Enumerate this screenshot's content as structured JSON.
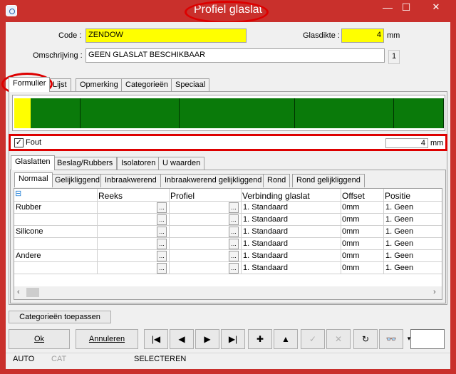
{
  "window": {
    "title": "Profiel glaslat",
    "minimize": "—",
    "maximize": "☐",
    "close": "✕"
  },
  "form": {
    "code_label": "Code :",
    "code_value": "ZENDOW",
    "glasdikte_label": "Glasdikte :",
    "glasdikte_value": "4",
    "glasdikte_unit": "mm",
    "omschrijving_label": "Omschrijving :",
    "omschrijving_value": "GEEN GLASLAT BESCHIKBAAR",
    "count_badge": "1"
  },
  "main_tabs": [
    "Formulier",
    "Lijst",
    "Opmerking",
    "Categorieën",
    "Speciaal"
  ],
  "strip": {
    "cells": 26,
    "selected_index": 0,
    "colors": {
      "selected": "#ffff00",
      "normal": "#0a7a0a"
    }
  },
  "fout": {
    "label": "Fout",
    "checked": true,
    "value": "4",
    "unit": "mm"
  },
  "sub_tabs": [
    "Glaslatten",
    "Beslag/Rubbers",
    "Isolatoren",
    "U waarden"
  ],
  "sub_sub_tabs": [
    "Normaal",
    "Gelijkliggend",
    "Inbraakwerend",
    "Inbraakwerend gelijkliggend",
    "Rond",
    "Rond gelijkliggend"
  ],
  "grid": {
    "columns": [
      "Reeks",
      "Profiel",
      "Verbinding glaslat",
      "Offset",
      "Positie"
    ],
    "collapse_icon": "⊟",
    "rows": [
      {
        "group": "Rubber",
        "verbinding": "1. Standaard",
        "offset": "0mm",
        "positie": "1. Geen"
      },
      {
        "group": "",
        "verbinding": "1. Standaard",
        "offset": "0mm",
        "positie": "1. Geen"
      },
      {
        "group": "Silicone",
        "verbinding": "1. Standaard",
        "offset": "0mm",
        "positie": "1. Geen"
      },
      {
        "group": "",
        "verbinding": "1. Standaard",
        "offset": "0mm",
        "positie": "1. Geen"
      },
      {
        "group": "Andere",
        "verbinding": "1. Standaard",
        "offset": "0mm",
        "positie": "1. Geen"
      },
      {
        "group": "",
        "verbinding": "1. Standaard",
        "offset": "0mm",
        "positie": "1. Geen"
      }
    ],
    "ellipsis": "..."
  },
  "buttons": {
    "categorieen": "Categorieën toepassen",
    "ok": "Ok",
    "annuleren": "Annuleren"
  },
  "nav": [
    "|◀",
    "◀",
    "▶",
    "▶|",
    "✚",
    "▲",
    "✓",
    "✕",
    "↻",
    "👓",
    "▾"
  ],
  "status": {
    "auto": "AUTO",
    "cat": "CAT",
    "mode": "SELECTEREN"
  }
}
